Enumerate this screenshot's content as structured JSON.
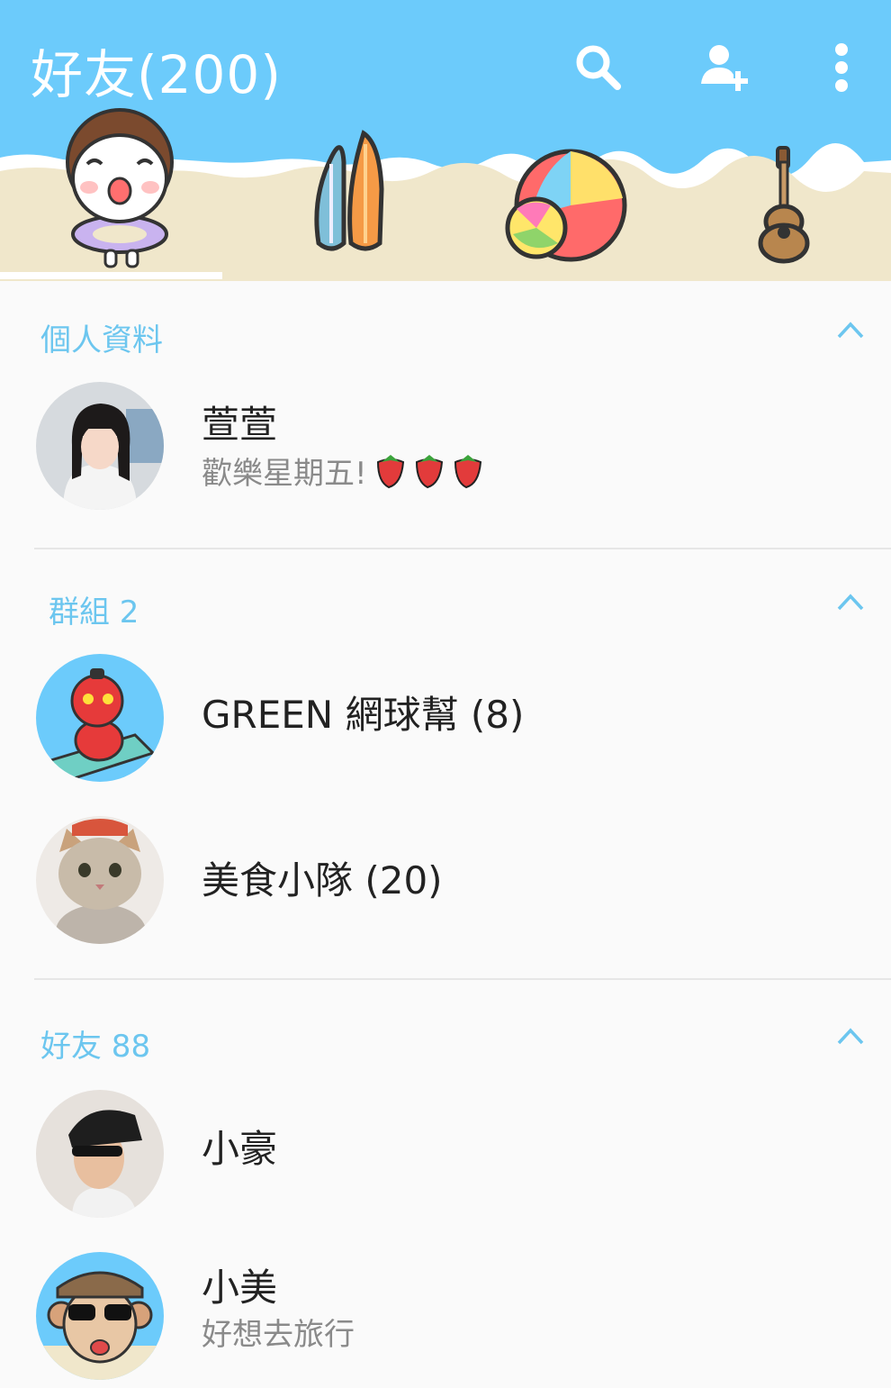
{
  "header": {
    "title": "好友(200)",
    "icons": [
      "search-icon",
      "add-friend-icon",
      "more-icon"
    ],
    "background_color": "#6ccbfb"
  },
  "tabs": [
    {
      "icon": "bear-sticker-icon"
    },
    {
      "icon": "surfboard-icon"
    },
    {
      "icon": "beach-ball-icon"
    },
    {
      "icon": "ukulele-icon"
    }
  ],
  "selected_tab_index": 0,
  "sections": {
    "profile": {
      "title": "個人資料",
      "items": [
        {
          "name": "萱萱",
          "status": "歡樂星期五!",
          "status_emoji": "strawberry-icon x3"
        }
      ]
    },
    "groups": {
      "title": "群組 2",
      "items": [
        {
          "name": "GREEN 網球幫 (8)"
        },
        {
          "name": "美食小隊 (20)"
        }
      ]
    },
    "friends": {
      "title": "好友 88",
      "items": [
        {
          "name": "小豪"
        },
        {
          "name": "小美",
          "status": "好想去旅行"
        }
      ]
    }
  },
  "colors": {
    "accent": "#6cc6ef",
    "divider": "#e6e6e6"
  }
}
